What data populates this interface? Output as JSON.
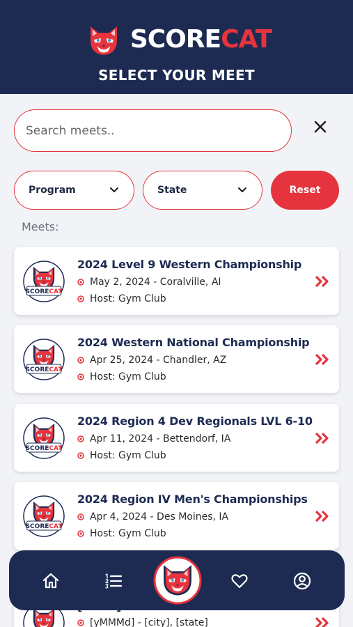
{
  "header": {
    "brand_left": "SCORE",
    "brand_right": "CAT",
    "subtitle": "SELECT YOUR MEET"
  },
  "search": {
    "placeholder": "Search meets..",
    "value": ""
  },
  "filters": {
    "program_label": "Program",
    "state_label": "State",
    "reset_label": "Reset"
  },
  "meets_label": "Meets:",
  "meets": [
    {
      "title": "2024 Level 9 Western Championship",
      "date_location": "May 2, 2024 - Coralville, AI",
      "host": "Host: Gym Club"
    },
    {
      "title": "2024 Western National Championship",
      "date_location": "Apr 25, 2024 - Chandler, AZ",
      "host": "Host: Gym Club"
    },
    {
      "title": "2024 Region 4 Dev Regionals LVL 6-10",
      "date_location": "Apr 11, 2024 - Bettendorf, IA",
      "host": "Host: Gym Club"
    },
    {
      "title": "2024 Region IV Men's Championships",
      "date_location": "Apr 4, 2024 - Des Moines, IA",
      "host": "Host: Gym Club"
    },
    {
      "title": "[name]",
      "date_location": "[yMMMd] - [city], [state]",
      "host": ""
    }
  ],
  "nav": [
    "home-icon",
    "list-icon",
    "scorecat-logo",
    "heart-icon",
    "account-icon"
  ],
  "colors": {
    "navy": "#1d2b52",
    "accent": "#e5343d",
    "background": "#f1f3f7"
  }
}
